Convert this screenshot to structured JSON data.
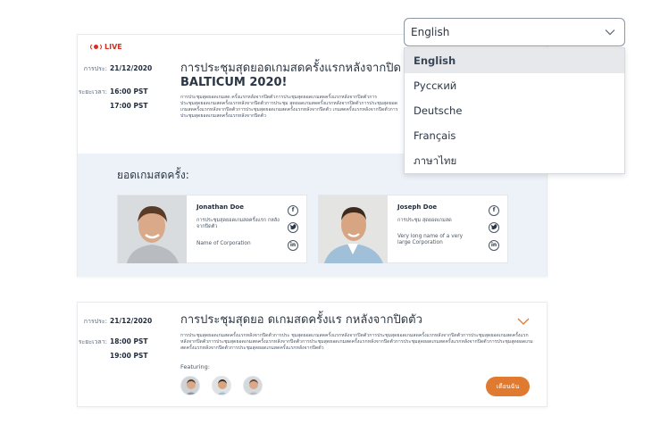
{
  "event1": {
    "live_label": "LIVE",
    "date_label": "การประ:",
    "date": "21/12/2020",
    "time_label": "ระยะเวลา:",
    "time_start": "16:00 PST",
    "time_end": "17:00 PST",
    "title_line1": "การประชุมสุดยอดเกมสดครั้งแรกหลังจากปิด",
    "title_line2": "BALTICUM 2020!",
    "description": "การประชุมสุดยอดเกมสด ครั้งแรกหลังจากปิดตัวการประชุมสุดยอดเกมสดครั้งแรกหลังจากปิดตัวการประชุมสุดยอดเกมสดครั้งแรกหลังจากปิดตัวการประชุม สุดยอดเกมสดครั้งแรกหลังจากปิดตัวการประชุมสุดยอดเกมสดครั้งแรกหลังจากปิดตัวการประชุมสุดยอดเกมสดครั้งแรกหลังจากปิดตัว เกมสดครั้งแรกหลังจากปิดตัวการประชุมสุดยอดเกมสดครั้งแรกหลังจากปิดตัว",
    "featured_heading": "ยอดเกมสดครั้ง:",
    "speakers": [
      {
        "name": "Jonathan Doe",
        "role": "การประชุมสุดยอดเกมสดครั้งแรก กหลังจากปิดตัว",
        "corp": "Name of Corporation"
      },
      {
        "name": "Joseph Doe",
        "role": "การประชุม สุดยอดเกมสด",
        "corp": "Very long name of a very large Corporation"
      }
    ],
    "social": {
      "facebook": "f",
      "twitter": "t",
      "linkedin": "in"
    }
  },
  "event2": {
    "date_label": "การประ:",
    "date": "21/12/2020",
    "time_label": "ระยะเวลา:",
    "time_start": "18:00 PST",
    "time_end": "19:00 PST",
    "title": "การประชุมสุดยอ ดเกมสดครั้งแร กหลังจากปิดตัว",
    "description": "การประชุมสุดยอดเกมสดครั้งแรกหลังจากปิดตัวการประ ชุมสุดยอดเกมสดครั้งแรกหลังจากปิดตัวการประชุมสุดยอดเกมสดครั้งแรกหลังจากปิดตัวการประชุมสุดยอดเกมสดครั้งแรกหลังจากปิดตัวการประชุมสุดยอดเกมสดครั้งแรกหลังจากปิดตัวการประชุมสุดยอดเกมสดครั้งแรกหลังจากปิดตัวการประชุมสุดยอดเกมสดครั้งแรกหลังจากปิดตัวการประชุมสุดยอดเกมสดครั้งแรกหลังจากปิดตัวการประชุมสุดยอดเกมสดครั้งแรกหลังจากปิดตัว",
    "featuring_label": "Featuring:",
    "remind_label": "เตือนฉัน"
  },
  "language_select": {
    "selected": "English",
    "options": [
      "English",
      "Русский",
      "Deutsche",
      "Français",
      "ภาษาไทย"
    ]
  },
  "colors": {
    "accent": "#e07a30",
    "live": "#d92d20",
    "featured_bg": "#edf2f8"
  },
  "icons": [
    "live-broadcast-icon",
    "chevron-down-icon",
    "facebook-icon",
    "twitter-icon",
    "linkedin-icon"
  ]
}
